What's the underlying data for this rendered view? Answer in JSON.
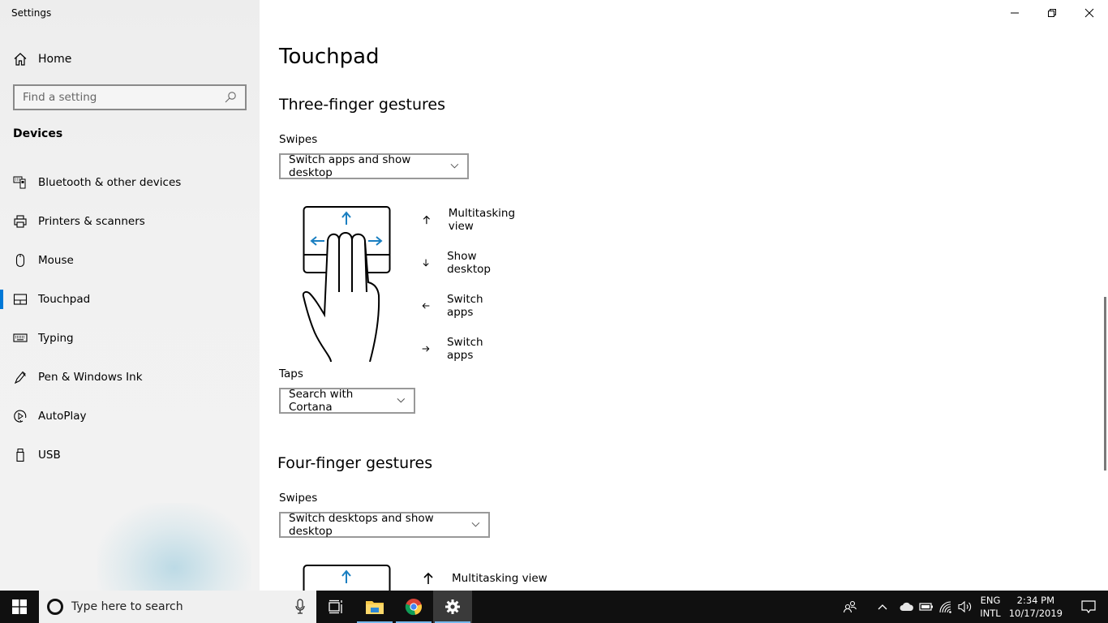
{
  "window": {
    "app_title": "Settings",
    "controls": {
      "minimize": "minimize",
      "restore": "restore",
      "close": "close"
    }
  },
  "sidebar": {
    "home_label": "Home",
    "search_placeholder": "Find a setting",
    "section_title": "Devices",
    "items": [
      {
        "label": "Bluetooth & other devices",
        "icon": "bluetooth-devices-icon",
        "active": false
      },
      {
        "label": "Printers & scanners",
        "icon": "printer-icon",
        "active": false
      },
      {
        "label": "Mouse",
        "icon": "mouse-icon",
        "active": false
      },
      {
        "label": "Touchpad",
        "icon": "touchpad-icon",
        "active": true
      },
      {
        "label": "Typing",
        "icon": "keyboard-icon",
        "active": false
      },
      {
        "label": "Pen & Windows Ink",
        "icon": "pen-icon",
        "active": false
      },
      {
        "label": "AutoPlay",
        "icon": "autoplay-icon",
        "active": false
      },
      {
        "label": "USB",
        "icon": "usb-icon",
        "active": false
      }
    ]
  },
  "main": {
    "page_title": "Touchpad",
    "three_finger": {
      "heading": "Three-finger gestures",
      "swipes_label": "Swipes",
      "swipes_value": "Switch apps and show desktop",
      "gestures": [
        {
          "direction": "up",
          "label": "Multitasking view"
        },
        {
          "direction": "down",
          "label": "Show desktop"
        },
        {
          "direction": "left",
          "label": "Switch apps"
        },
        {
          "direction": "right",
          "label": "Switch apps"
        }
      ],
      "taps_label": "Taps",
      "taps_value": "Search with Cortana"
    },
    "four_finger": {
      "heading": "Four-finger gestures",
      "swipes_label": "Swipes",
      "swipes_value": "Switch desktops and show desktop",
      "gestures": [
        {
          "direction": "up",
          "label": "Multitasking view"
        }
      ]
    }
  },
  "taskbar": {
    "search_placeholder": "Type here to search",
    "apps": [
      {
        "name": "task-view",
        "running": false,
        "active": false
      },
      {
        "name": "file-explorer",
        "running": true,
        "active": false
      },
      {
        "name": "chrome",
        "running": true,
        "active": false
      },
      {
        "name": "settings",
        "running": true,
        "active": true
      }
    ],
    "tray": {
      "language_top": "ENG",
      "language_bottom": "INTL",
      "time": "2:34 PM",
      "date": "10/17/2019"
    }
  },
  "colors": {
    "accent": "#0078d7",
    "gesture_arrow": "#1a7fc1",
    "taskbar_bg": "#101010"
  }
}
